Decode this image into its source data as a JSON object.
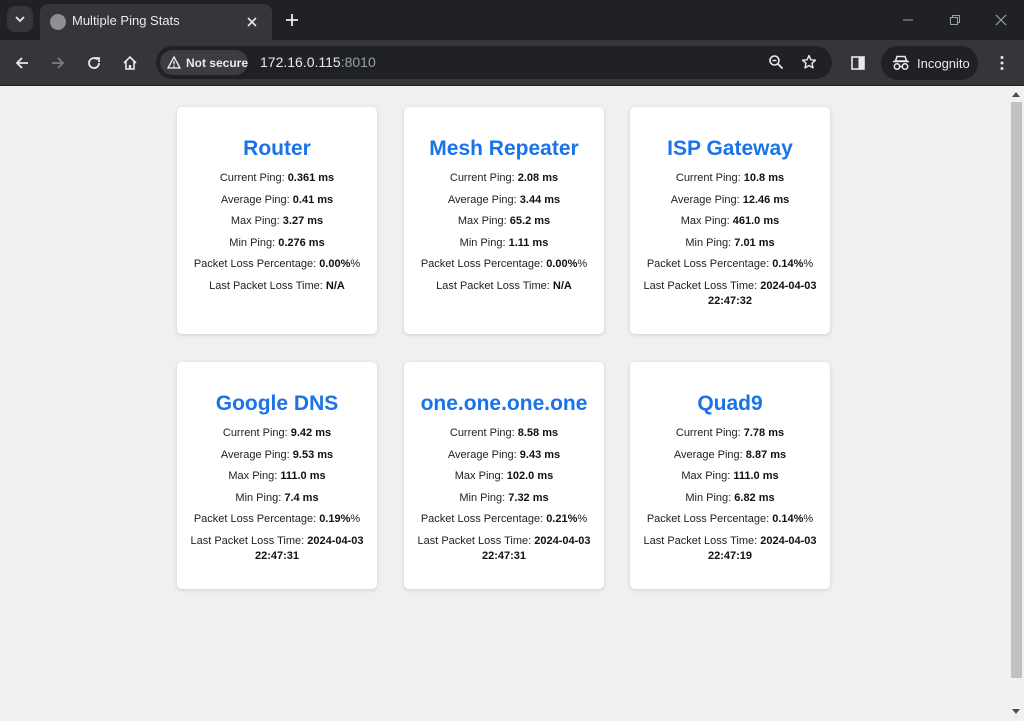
{
  "browser": {
    "tab_title": "Multiple Ping Stats",
    "security_label": "Not secure",
    "url_host": "172.16.0.115",
    "url_port": ":8010",
    "incognito_label": "Incognito"
  },
  "cards": [
    {
      "title": "Router",
      "current_label": "Current Ping:",
      "current": "0.361 ms",
      "average_label": "Average Ping:",
      "average": "0.41 ms",
      "max_label": "Max Ping:",
      "max": "3.27 ms",
      "min_label": "Min Ping:",
      "min": "0.276 ms",
      "loss_label": "Packet Loss Percentage:",
      "loss": "0.00%",
      "last_label": "Last Packet Loss Time:",
      "last": "N/A"
    },
    {
      "title": "Mesh Repeater",
      "current_label": "Current Ping:",
      "current": "2.08 ms",
      "average_label": "Average Ping:",
      "average": "3.44 ms",
      "max_label": "Max Ping:",
      "max": "65.2 ms",
      "min_label": "Min Ping:",
      "min": "1.11 ms",
      "loss_label": "Packet Loss Percentage:",
      "loss": "0.00%",
      "last_label": "Last Packet Loss Time:",
      "last": "N/A"
    },
    {
      "title": "ISP Gateway",
      "current_label": "Current Ping:",
      "current": "10.8 ms",
      "average_label": "Average Ping:",
      "average": "12.46 ms",
      "max_label": "Max Ping:",
      "max": "461.0 ms",
      "min_label": "Min Ping:",
      "min": "7.01 ms",
      "loss_label": "Packet Loss Percentage:",
      "loss": "0.14%",
      "last_label": "Last Packet Loss Time:",
      "last": "2024-04-03 22:47:32"
    },
    {
      "title": "Google DNS",
      "current_label": "Current Ping:",
      "current": "9.42 ms",
      "average_label": "Average Ping:",
      "average": "9.53 ms",
      "max_label": "Max Ping:",
      "max": "111.0 ms",
      "min_label": "Min Ping:",
      "min": "7.4 ms",
      "loss_label": "Packet Loss Percentage:",
      "loss": "0.19%",
      "last_label": "Last Packet Loss Time:",
      "last": "2024-04-03 22:47:31"
    },
    {
      "title": "one.one.one.one",
      "current_label": "Current Ping:",
      "current": "8.58 ms",
      "average_label": "Average Ping:",
      "average": "9.43 ms",
      "max_label": "Max Ping:",
      "max": "102.0 ms",
      "min_label": "Min Ping:",
      "min": "7.32 ms",
      "loss_label": "Packet Loss Percentage:",
      "loss": "0.21%",
      "last_label": "Last Packet Loss Time:",
      "last": "2024-04-03 22:47:31"
    },
    {
      "title": "Quad9",
      "current_label": "Current Ping:",
      "current": "7.78 ms",
      "average_label": "Average Ping:",
      "average": "8.87 ms",
      "max_label": "Max Ping:",
      "max": "111.0 ms",
      "min_label": "Min Ping:",
      "min": "6.82 ms",
      "loss_label": "Packet Loss Percentage:",
      "loss": "0.14%",
      "last_label": "Last Packet Loss Time:",
      "last": "2024-04-03 22:47:19"
    }
  ],
  "colors": {
    "card_title": "#1a73e8",
    "page_background": "#f0f0f0",
    "toolbar": "#35363a",
    "tabstrip": "#202124"
  }
}
